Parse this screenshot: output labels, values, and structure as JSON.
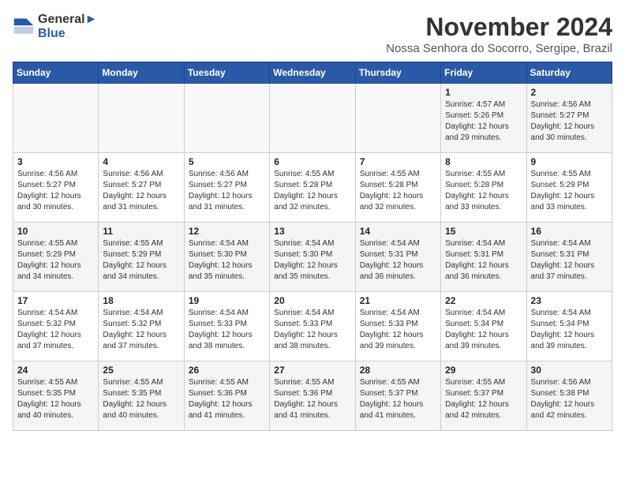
{
  "header": {
    "logo_line1": "General",
    "logo_line2": "Blue",
    "title": "November 2024",
    "subtitle": "Nossa Senhora do Socorro, Sergipe, Brazil"
  },
  "weekdays": [
    "Sunday",
    "Monday",
    "Tuesday",
    "Wednesday",
    "Thursday",
    "Friday",
    "Saturday"
  ],
  "weeks": [
    [
      {
        "day": "",
        "info": ""
      },
      {
        "day": "",
        "info": ""
      },
      {
        "day": "",
        "info": ""
      },
      {
        "day": "",
        "info": ""
      },
      {
        "day": "",
        "info": ""
      },
      {
        "day": "1",
        "info": "Sunrise: 4:57 AM\nSunset: 5:26 PM\nDaylight: 12 hours and 29 minutes."
      },
      {
        "day": "2",
        "info": "Sunrise: 4:56 AM\nSunset: 5:27 PM\nDaylight: 12 hours and 30 minutes."
      }
    ],
    [
      {
        "day": "3",
        "info": "Sunrise: 4:56 AM\nSunset: 5:27 PM\nDaylight: 12 hours and 30 minutes."
      },
      {
        "day": "4",
        "info": "Sunrise: 4:56 AM\nSunset: 5:27 PM\nDaylight: 12 hours and 31 minutes."
      },
      {
        "day": "5",
        "info": "Sunrise: 4:56 AM\nSunset: 5:27 PM\nDaylight: 12 hours and 31 minutes."
      },
      {
        "day": "6",
        "info": "Sunrise: 4:55 AM\nSunset: 5:28 PM\nDaylight: 12 hours and 32 minutes."
      },
      {
        "day": "7",
        "info": "Sunrise: 4:55 AM\nSunset: 5:28 PM\nDaylight: 12 hours and 32 minutes."
      },
      {
        "day": "8",
        "info": "Sunrise: 4:55 AM\nSunset: 5:28 PM\nDaylight: 12 hours and 33 minutes."
      },
      {
        "day": "9",
        "info": "Sunrise: 4:55 AM\nSunset: 5:29 PM\nDaylight: 12 hours and 33 minutes."
      }
    ],
    [
      {
        "day": "10",
        "info": "Sunrise: 4:55 AM\nSunset: 5:29 PM\nDaylight: 12 hours and 34 minutes."
      },
      {
        "day": "11",
        "info": "Sunrise: 4:55 AM\nSunset: 5:29 PM\nDaylight: 12 hours and 34 minutes."
      },
      {
        "day": "12",
        "info": "Sunrise: 4:54 AM\nSunset: 5:30 PM\nDaylight: 12 hours and 35 minutes."
      },
      {
        "day": "13",
        "info": "Sunrise: 4:54 AM\nSunset: 5:30 PM\nDaylight: 12 hours and 35 minutes."
      },
      {
        "day": "14",
        "info": "Sunrise: 4:54 AM\nSunset: 5:31 PM\nDaylight: 12 hours and 36 minutes."
      },
      {
        "day": "15",
        "info": "Sunrise: 4:54 AM\nSunset: 5:31 PM\nDaylight: 12 hours and 36 minutes."
      },
      {
        "day": "16",
        "info": "Sunrise: 4:54 AM\nSunset: 5:31 PM\nDaylight: 12 hours and 37 minutes."
      }
    ],
    [
      {
        "day": "17",
        "info": "Sunrise: 4:54 AM\nSunset: 5:32 PM\nDaylight: 12 hours and 37 minutes."
      },
      {
        "day": "18",
        "info": "Sunrise: 4:54 AM\nSunset: 5:32 PM\nDaylight: 12 hours and 37 minutes."
      },
      {
        "day": "19",
        "info": "Sunrise: 4:54 AM\nSunset: 5:33 PM\nDaylight: 12 hours and 38 minutes."
      },
      {
        "day": "20",
        "info": "Sunrise: 4:54 AM\nSunset: 5:33 PM\nDaylight: 12 hours and 38 minutes."
      },
      {
        "day": "21",
        "info": "Sunrise: 4:54 AM\nSunset: 5:33 PM\nDaylight: 12 hours and 39 minutes."
      },
      {
        "day": "22",
        "info": "Sunrise: 4:54 AM\nSunset: 5:34 PM\nDaylight: 12 hours and 39 minutes."
      },
      {
        "day": "23",
        "info": "Sunrise: 4:54 AM\nSunset: 5:34 PM\nDaylight: 12 hours and 39 minutes."
      }
    ],
    [
      {
        "day": "24",
        "info": "Sunrise: 4:55 AM\nSunset: 5:35 PM\nDaylight: 12 hours and 40 minutes."
      },
      {
        "day": "25",
        "info": "Sunrise: 4:55 AM\nSunset: 5:35 PM\nDaylight: 12 hours and 40 minutes."
      },
      {
        "day": "26",
        "info": "Sunrise: 4:55 AM\nSunset: 5:36 PM\nDaylight: 12 hours and 41 minutes."
      },
      {
        "day": "27",
        "info": "Sunrise: 4:55 AM\nSunset: 5:36 PM\nDaylight: 12 hours and 41 minutes."
      },
      {
        "day": "28",
        "info": "Sunrise: 4:55 AM\nSunset: 5:37 PM\nDaylight: 12 hours and 41 minutes."
      },
      {
        "day": "29",
        "info": "Sunrise: 4:55 AM\nSunset: 5:37 PM\nDaylight: 12 hours and 42 minutes."
      },
      {
        "day": "30",
        "info": "Sunrise: 4:56 AM\nSunset: 5:38 PM\nDaylight: 12 hours and 42 minutes."
      }
    ]
  ]
}
